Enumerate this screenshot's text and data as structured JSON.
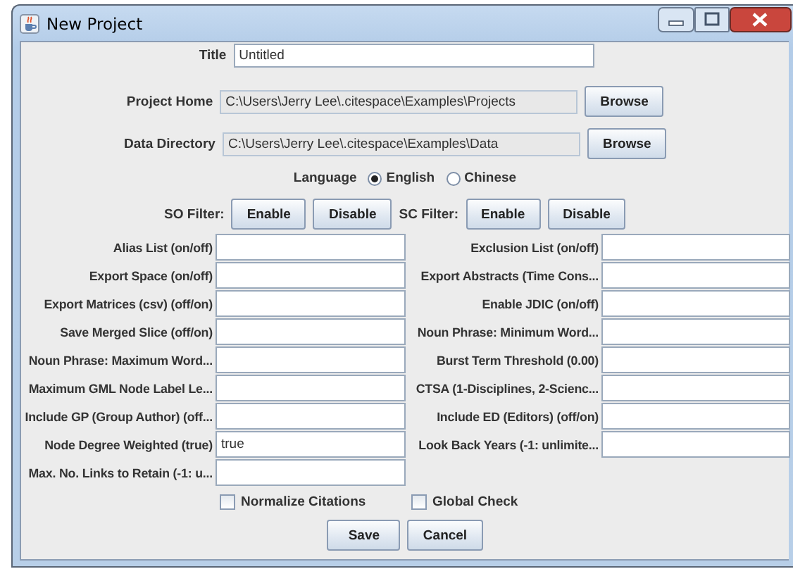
{
  "window": {
    "title": "New Project"
  },
  "title_field": {
    "label": "Title",
    "value": "Untitled"
  },
  "paths": [
    {
      "label": "Project Home",
      "value": "C:\\Users\\Jerry Lee\\.citespace\\Examples\\Projects",
      "button": "Browse"
    },
    {
      "label": "Data Directory",
      "value": "C:\\Users\\Jerry Lee\\.citespace\\Examples\\Data",
      "button": "Browse"
    }
  ],
  "language": {
    "label": "Language",
    "options": [
      {
        "label": "English",
        "selected": true
      },
      {
        "label": "Chinese",
        "selected": false
      }
    ]
  },
  "filters": [
    {
      "label": "SO Filter:",
      "buttons": [
        "Enable",
        "Disable"
      ]
    },
    {
      "label": "SC Filter:",
      "buttons": [
        "Enable",
        "Disable"
      ]
    }
  ],
  "parameter_rows": [
    [
      {
        "label": "Alias List (on/off)"
      },
      {
        "label": "Exclusion List (on/off)"
      }
    ],
    [
      {
        "label": "Export Space (on/off)"
      },
      {
        "label": "Export Abstracts (Time Cons..."
      }
    ],
    [
      {
        "label": "Export Matrices (csv) (off/on)"
      },
      {
        "label": "Enable JDIC (on/off)"
      }
    ],
    [
      {
        "label": "Save Merged Slice (off/on)"
      },
      {
        "label": "Noun Phrase: Minimum Word..."
      }
    ],
    [
      {
        "label": "Noun Phrase: Maximum Word..."
      },
      {
        "label": "Burst Term Threshold (0.00)"
      }
    ],
    [
      {
        "label": "Maximum GML Node Label Le..."
      },
      {
        "label": "CTSA (1-Disciplines, 2-Scienc..."
      }
    ],
    [
      {
        "label": "Include GP (Group Author) (off..."
      },
      {
        "label": "Include ED (Editors) (off/on)"
      }
    ],
    [
      {
        "label": "Node Degree Weighted (true)",
        "value": "true"
      },
      {
        "label": "Look Back Years (-1: unlimite..."
      }
    ],
    [
      {
        "label": "Max. No. Links to Retain (-1: u..."
      }
    ]
  ],
  "checkboxes": [
    {
      "label": "Normalize Citations",
      "checked": false
    },
    {
      "label": "Global Check",
      "checked": false
    }
  ],
  "buttons": [
    "Save",
    "Cancel"
  ]
}
